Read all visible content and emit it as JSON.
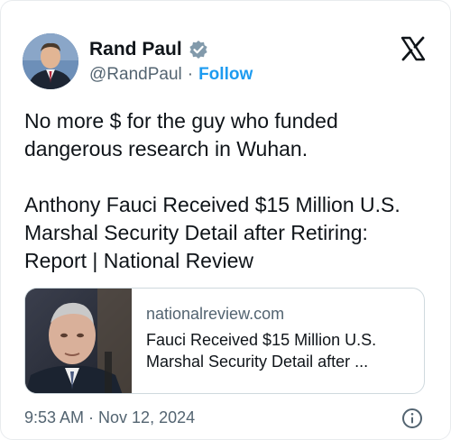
{
  "author": {
    "name": "Rand Paul",
    "handle": "@RandPaul",
    "separator": "·",
    "follow_label": "Follow",
    "verified_icon": "verified-badge-icon"
  },
  "tweet": {
    "line1": "No more $ for the guy who funded dangerous research in Wuhan.",
    "line2": "Anthony Fauci Received $15 Million U.S. Marshal Security Detail after Retiring: Report | National Review"
  },
  "link_card": {
    "domain": "nationalreview.com",
    "title": "Fauci Received $15 Million U.S. Marshal Security Detail after ..."
  },
  "footer": {
    "timestamp": "9:53 AM · Nov 12, 2024"
  },
  "colors": {
    "accent": "#1d9bf0",
    "text": "#0f1419",
    "muted": "#536471"
  }
}
